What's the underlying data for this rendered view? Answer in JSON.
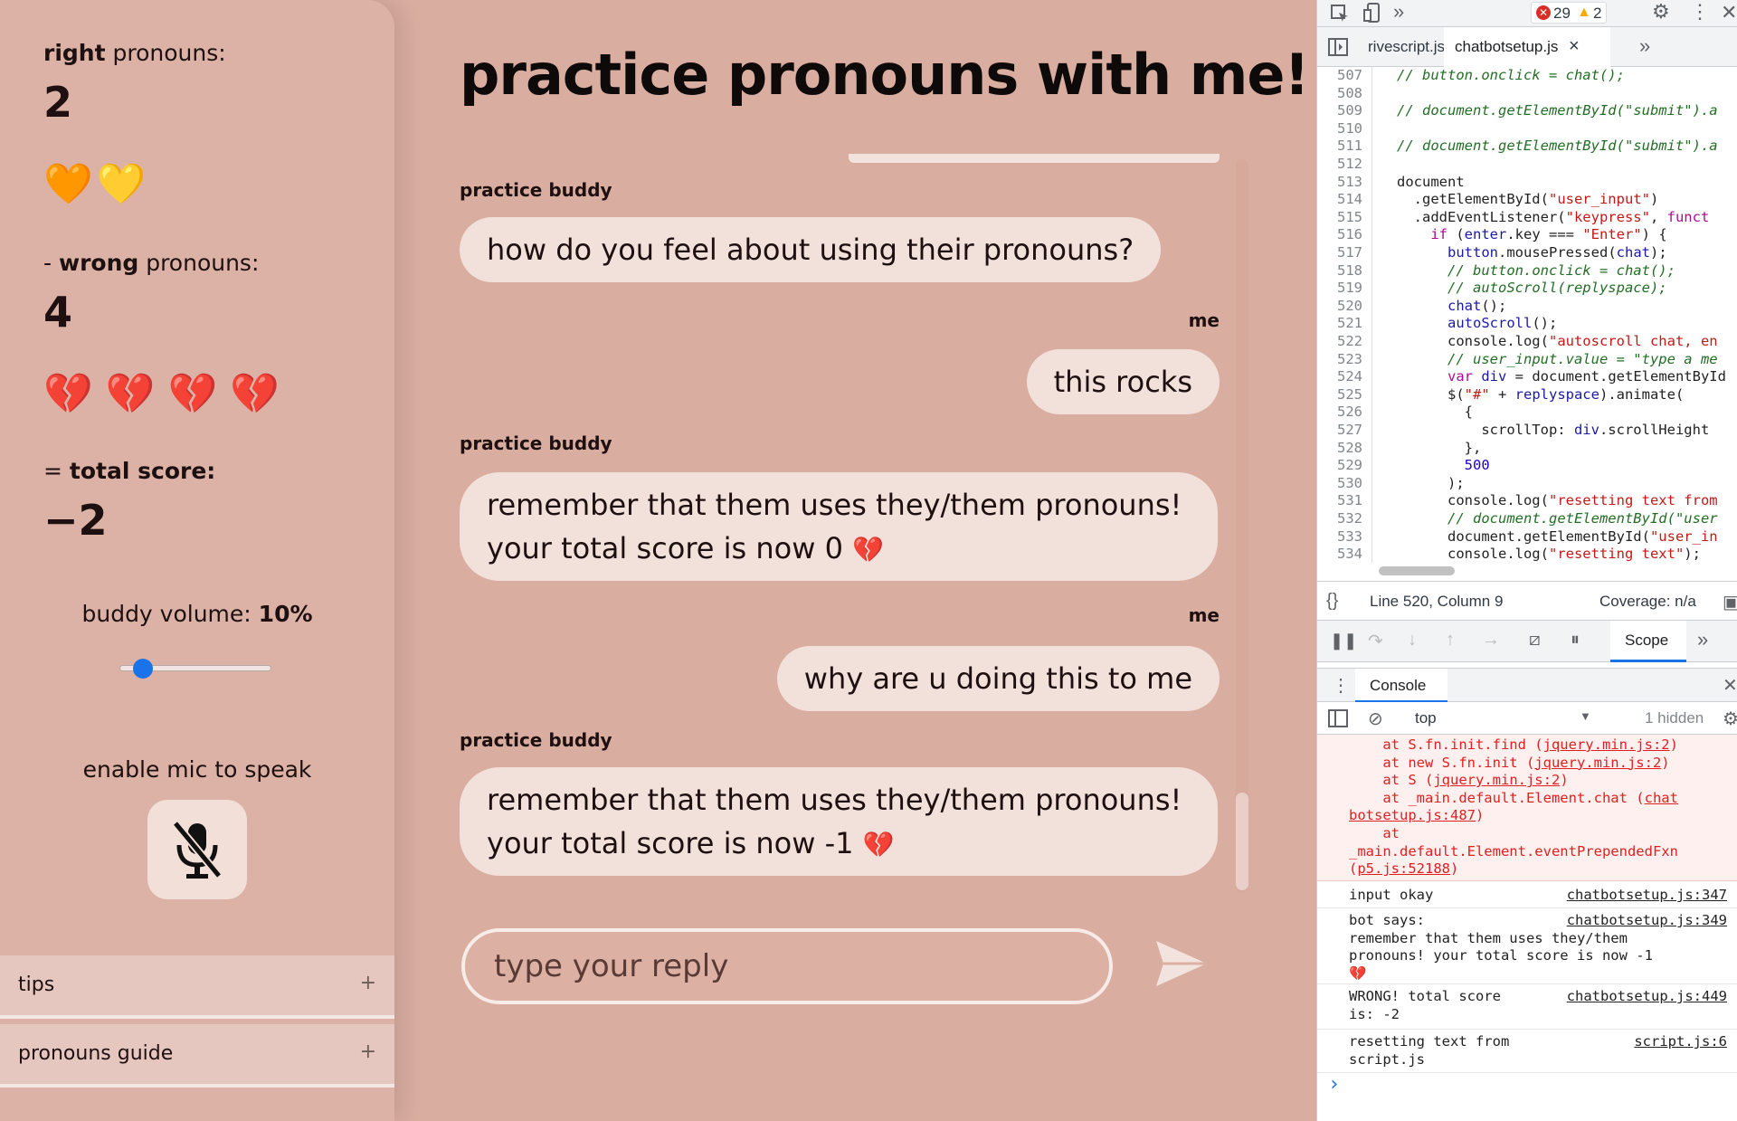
{
  "sidebar": {
    "right_label_bold": "right",
    "right_label_rest": " pronouns:",
    "right_count": "2",
    "right_hearts": "🧡💛",
    "wrong_label_prefix": "- ",
    "wrong_label_bold": "wrong",
    "wrong_label_rest": " pronouns:",
    "wrong_count": "4",
    "wrong_hearts": "💔 💔 💔 💔",
    "total_label_prefix": "= ",
    "total_label_bold": "total score:",
    "total_value": "−2",
    "volume_label": "buddy volume: ",
    "volume_value": "10%",
    "volume_level": 0.1,
    "mic_label": "enable mic to speak",
    "accordions": [
      {
        "label": "tips",
        "icon": "+"
      },
      {
        "label": "pronouns guide",
        "icon": "+"
      }
    ]
  },
  "chat": {
    "title": "practice pronouns with me!",
    "messages": [
      {
        "sender": "practice buddy",
        "text": "how do you feel about using their pronouns?"
      },
      {
        "sender": "me",
        "text": "this rocks"
      },
      {
        "sender": "practice buddy",
        "line1": "remember that them uses they/them pronouns!",
        "line2": "your total score is now 0",
        "heart": "💔"
      },
      {
        "sender": "me",
        "text": "why are u doing this to me"
      },
      {
        "sender": "practice buddy",
        "line1": "remember that them uses they/them pronouns!",
        "line2": "your total score is now -1",
        "heart": "💔"
      }
    ],
    "input_placeholder": "type your reply"
  },
  "devtools": {
    "error_count": "29",
    "warning_count": "2",
    "tabs": [
      "rivescript.js",
      "chatbotsetup.js"
    ],
    "close_glyph": "×",
    "more_glyph": "»",
    "code_lines": [
      {
        "n": "507",
        "html": "<span class='cm'>// button.onclick = chat();</span>"
      },
      {
        "n": "508",
        "html": ""
      },
      {
        "n": "509",
        "html": "<span class='cm'>// document.getElementById(\"submit\").a</span>"
      },
      {
        "n": "510",
        "html": ""
      },
      {
        "n": "511",
        "html": "<span class='cm'>// document.getElementById(\"submit\").a</span>"
      },
      {
        "n": "512",
        "html": ""
      },
      {
        "n": "513",
        "html": "document"
      },
      {
        "n": "514",
        "html": "  .getElementById(<span class='st'>\"user_input\"</span>)"
      },
      {
        "n": "515",
        "html": "  .addEventListener(<span class='st'>\"keypress\"</span>, <span class='kw'>funct</span>"
      },
      {
        "n": "516",
        "html": "    <span class='kw'>if</span> (<span class='va'>enter</span>.key === <span class='st'>\"Enter\"</span>) {"
      },
      {
        "n": "517",
        "html": "      <span class='va'>button</span>.mousePressed(<span class='va'>chat</span>);"
      },
      {
        "n": "518",
        "html": "      <span class='cm'>// button.onclick = chat();</span>"
      },
      {
        "n": "519",
        "html": "      <span class='cm'>// autoScroll(replyspace);</span>"
      },
      {
        "n": "520",
        "html": "      <span class='va'>chat</span>();"
      },
      {
        "n": "521",
        "html": "      <span class='va'>autoScroll</span>();"
      },
      {
        "n": "522",
        "html": "      console.log(<span class='st'>\"autoscroll chat, en</span>"
      },
      {
        "n": "523",
        "html": "      <span class='cm'>// user_input.value = \"type a me</span>"
      },
      {
        "n": "524",
        "html": "      <span class='kw'>var</span> <span class='va'>div</span> = document.getElementById"
      },
      {
        "n": "525",
        "html": "      $(<span class='st'>\"#\"</span> + <span class='va'>replyspace</span>).animate("
      },
      {
        "n": "526",
        "html": "        {"
      },
      {
        "n": "527",
        "html": "          scrollTop: <span class='va'>div</span>.scrollHeight"
      },
      {
        "n": "528",
        "html": "        },"
      },
      {
        "n": "529",
        "html": "        <span class='nm'>500</span>"
      },
      {
        "n": "530",
        "html": "      );"
      },
      {
        "n": "531",
        "html": "      console.log(<span class='st'>\"resetting text from</span>"
      },
      {
        "n": "532",
        "html": "      <span class='cm'>// document.getElementById(\"user</span>"
      },
      {
        "n": "533",
        "html": "      document.getElementById(<span class='st'>\"user_in</span>"
      },
      {
        "n": "534",
        "html": "      console.log(<span class='st'>\"resetting text\"</span>);"
      },
      {
        "n": "535",
        "html": ""
      }
    ],
    "status_position": "Line 520, Column 9",
    "status_coverage": "Coverage: n/a",
    "scope_tab": "Scope",
    "console_tab": "Console",
    "context": "top",
    "hidden_count": "1 hidden",
    "error_lines": [
      "    at S.fn.init.find (<u>jquery.min.js:2</u>)",
      "    at new S.fn.init (<u>jquery.min.js:2</u>)",
      "    at S (<u>jquery.min.js:2</u>)",
      "    at _main.default.Element.chat (<u>chat</u>",
      "<u>botsetup.js:487</u>)",
      "    at",
      "_main.default.Element.eventPrependedFxn",
      "(<u>p5.js:52188</u>)"
    ],
    "logs": [
      {
        "text": "input okay",
        "link": "chatbotsetup.js:347"
      },
      {
        "text": "bot says:\nremember that them uses they/them\npronouns! your total score is now -1\n💔",
        "link": "chatbotsetup.js:349"
      },
      {
        "text": "WRONG! total score\nis: -2",
        "link": "chatbotsetup.js:449"
      },
      {
        "text": "resetting text from\nscript.js",
        "link": "script.js:6"
      }
    ],
    "prompt": "›"
  }
}
